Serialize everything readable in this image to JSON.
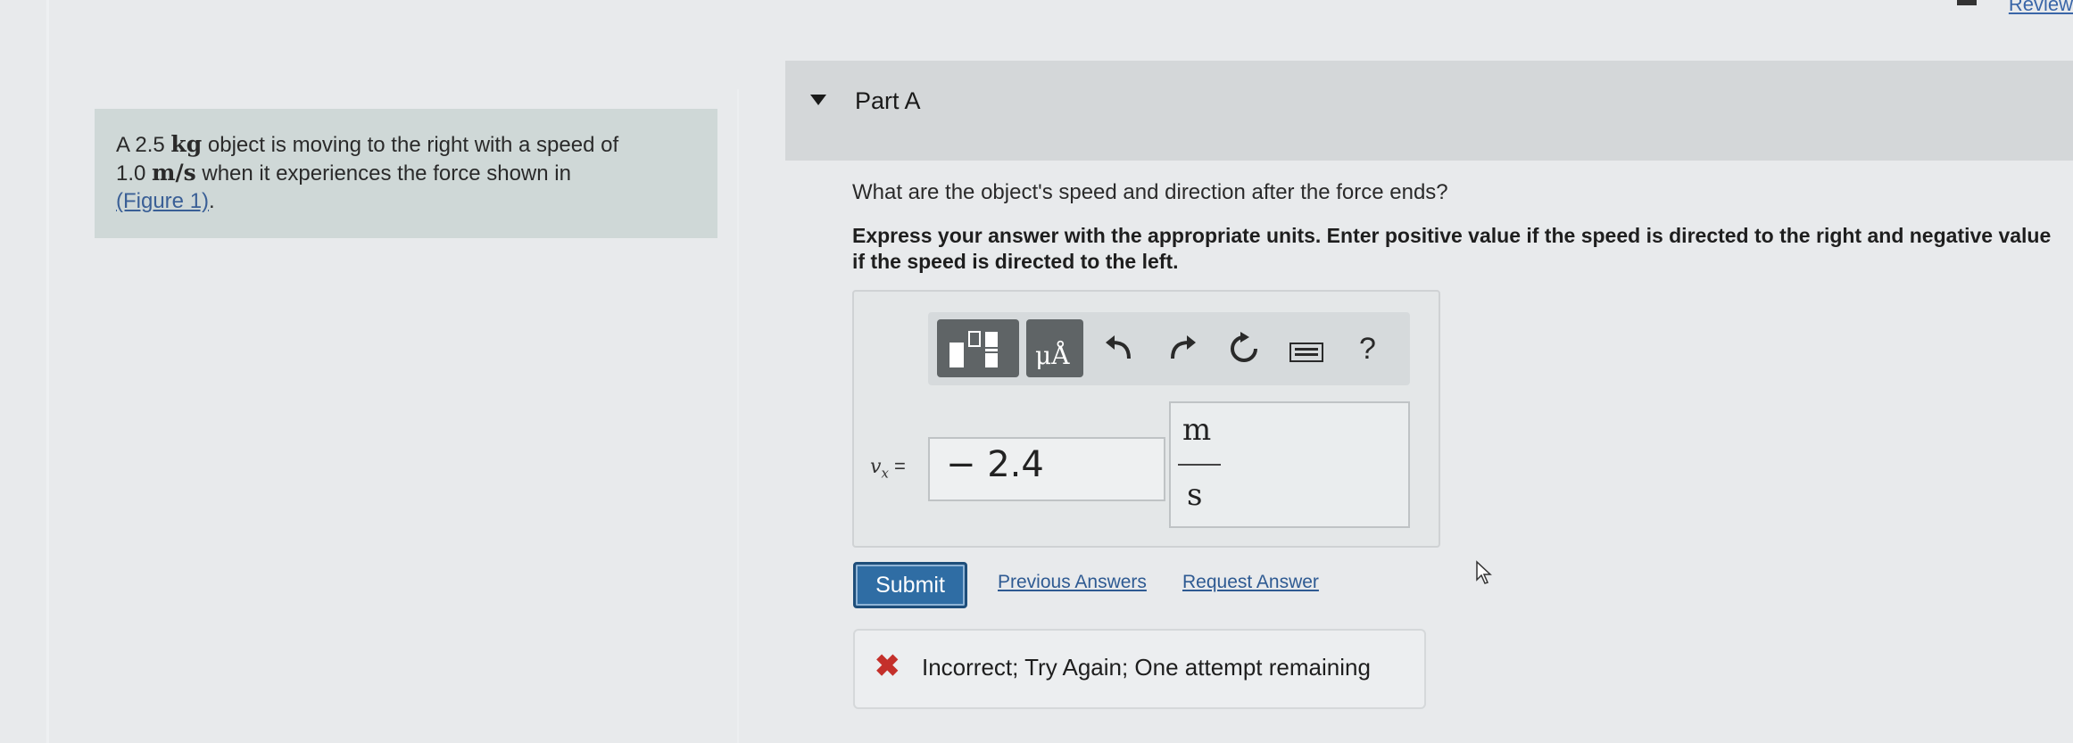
{
  "header": {
    "review_link": "Review"
  },
  "problem": {
    "text_part1": "A 2.5 ",
    "mass_unit": "kg",
    "text_part2": " object is moving to the right with a speed of",
    "speed": "1.0 ",
    "speed_unit": "m/s",
    "text_part3": " when it experiences the force shown in",
    "figure_link": "(Figure 1)",
    "text_part4": "."
  },
  "part": {
    "title": "Part A",
    "question": "What are the object's speed and direction after the force ends?",
    "instruction": "Express your answer with the appropriate units. Enter positive value if the speed is directed to the right and negative value if the speed is directed to the left."
  },
  "toolbar": {
    "units_button": "μÅ",
    "help": "?",
    "icons": [
      "templates-icon",
      "units-icon",
      "undo-icon",
      "redo-icon",
      "reset-icon",
      "keyboard-icon",
      "help-icon"
    ]
  },
  "answer": {
    "variable_label": "v",
    "variable_sub": "x",
    "equals": " =",
    "value": "− 2.4",
    "unit_numerator": "m",
    "unit_denominator": "s"
  },
  "actions": {
    "submit": "Submit",
    "previous_answers": "Previous Answers",
    "request_answer": "Request Answer"
  },
  "feedback": {
    "icon": "x-icon",
    "text": "Incorrect; Try Again; One attempt remaining",
    "color": "#c4302b"
  }
}
